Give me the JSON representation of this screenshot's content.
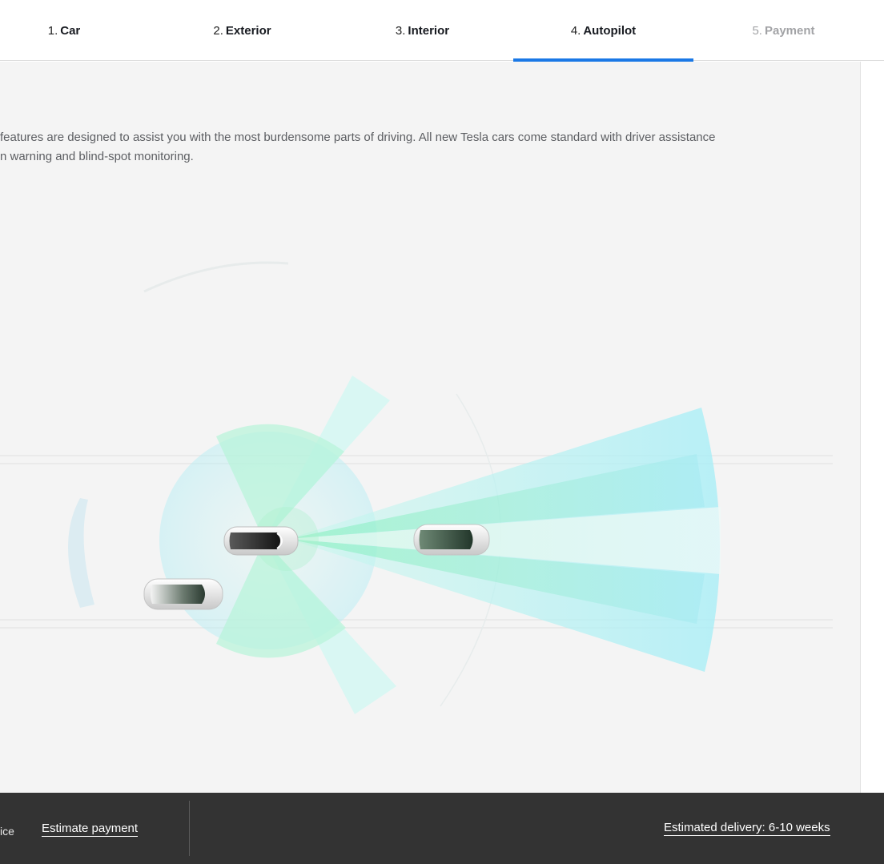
{
  "steps": [
    {
      "num": "1.",
      "label": "Car"
    },
    {
      "num": "2.",
      "label": "Exterior"
    },
    {
      "num": "3.",
      "label": "Interior"
    },
    {
      "num": "4.",
      "label": "Autopilot"
    },
    {
      "num": "5.",
      "label": "Payment"
    }
  ],
  "active_step": "Autopilot",
  "main": {
    "description": "features are designed to assist you with the most burdensome parts of driving. All new Tesla cars come standard with driver assistance\nn warning and blind-spot monitoring."
  },
  "footer": {
    "price_fragment": "ice",
    "estimate_payment": "Estimate payment",
    "delivery": "Estimated delivery: 6-10 weeks"
  },
  "colors": {
    "accent": "#1a78e6",
    "footer_bg": "#333333",
    "main_bg": "#f4f4f4"
  }
}
